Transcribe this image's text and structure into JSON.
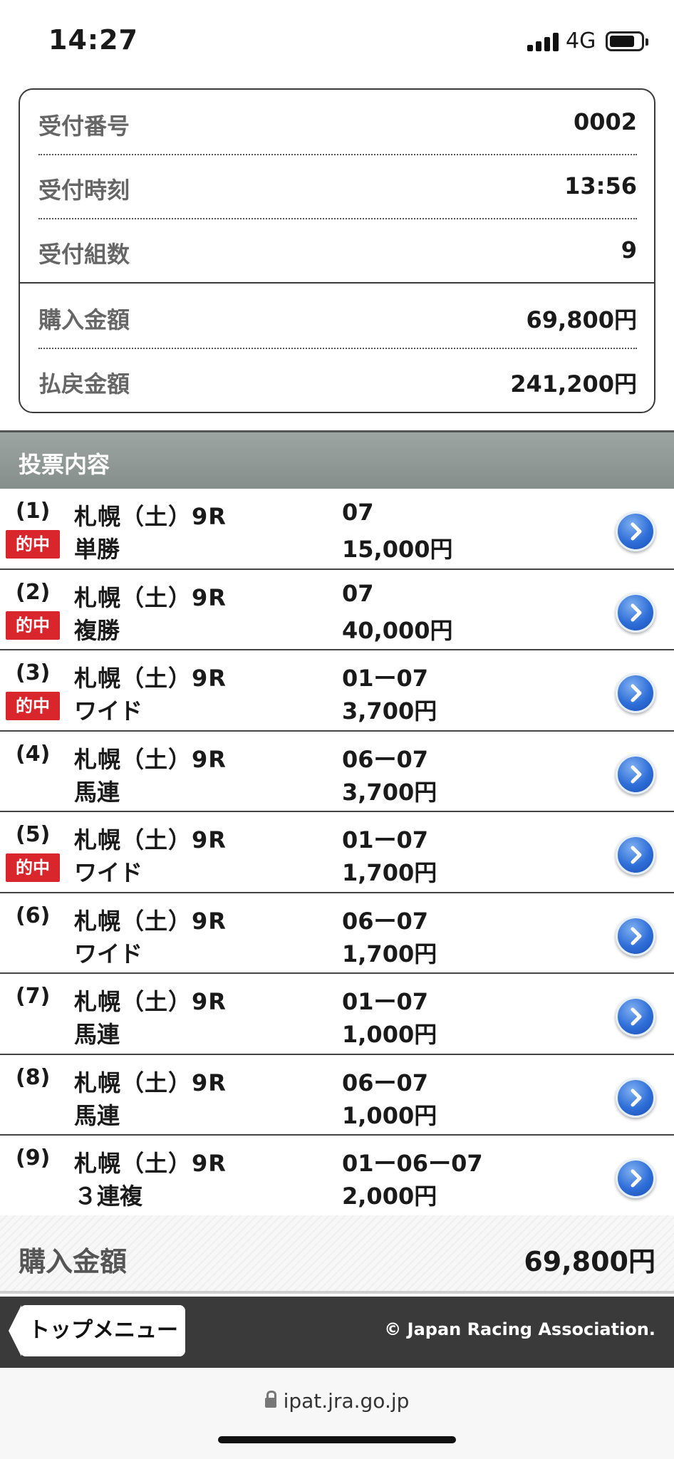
{
  "status_bar": {
    "time": "14:27",
    "network": "4G",
    "icons": [
      "signal-icon",
      "battery-icon"
    ]
  },
  "summary": {
    "rows": [
      {
        "label": "受付番号",
        "value": "0002"
      },
      {
        "label": "受付時刻",
        "value": "13:56"
      },
      {
        "label": "受付組数",
        "value": "9"
      },
      {
        "label": "購入金額",
        "value": "69,800円"
      },
      {
        "label": "払戻金額",
        "value": "241,200円"
      }
    ]
  },
  "section": {
    "title": "投票内容"
  },
  "bets": [
    {
      "no": "(1)",
      "race": "札幌（土）9R",
      "type": "単勝",
      "combo": "07",
      "amount": "15,000円",
      "hit": "的中"
    },
    {
      "no": "(2)",
      "race": "札幌（土）9R",
      "type": "複勝",
      "combo": "07",
      "amount": "40,000円",
      "hit": "的中"
    },
    {
      "no": "(3)",
      "race": "札幌（土）9R",
      "type": "ワイド",
      "combo": "01ー07",
      "amount": "3,700円",
      "hit": "的中"
    },
    {
      "no": "(4)",
      "race": "札幌（土）9R",
      "type": "馬連",
      "combo": "06ー07",
      "amount": "3,700円",
      "hit": ""
    },
    {
      "no": "(5)",
      "race": "札幌（土）9R",
      "type": "ワイド",
      "combo": "01ー07",
      "amount": "1,700円",
      "hit": "的中"
    },
    {
      "no": "(6)",
      "race": "札幌（土）9R",
      "type": "ワイド",
      "combo": "06ー07",
      "amount": "1,700円",
      "hit": ""
    },
    {
      "no": "(7)",
      "race": "札幌（土）9R",
      "type": "馬連",
      "combo": "01ー07",
      "amount": "1,000円",
      "hit": ""
    },
    {
      "no": "(8)",
      "race": "札幌（土）9R",
      "type": "馬連",
      "combo": "06ー07",
      "amount": "1,000円",
      "hit": ""
    },
    {
      "no": "(9)",
      "race": "札幌（土）9R",
      "type": "３連複",
      "combo": "01ー06ー07",
      "amount": "2,000円",
      "hit": ""
    }
  ],
  "total": {
    "label": "購入金額",
    "value": "69,800円"
  },
  "nav": {
    "top_menu_label": "トップメニュー",
    "copyright": "© Japan Racing Association."
  },
  "browser": {
    "url": "ipat.jra.go.jp"
  },
  "colors": {
    "hit_badge": "#d9262c",
    "section_header": "#8f9794",
    "arrow_button": "#2f6ed8"
  }
}
